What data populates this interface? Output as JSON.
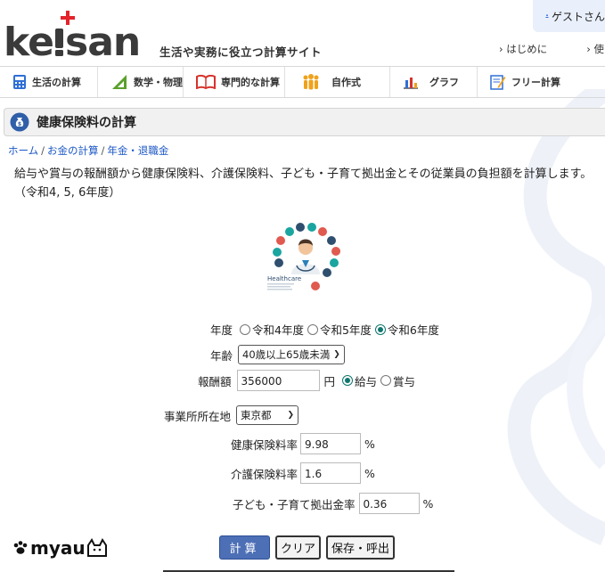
{
  "header": {
    "guest_label": "ゲストさん",
    "logo_text": "keisan",
    "tagline": "生活や実務に役立つ計算サイト",
    "links": [
      "はじめに",
      "使い"
    ]
  },
  "nav": {
    "items": [
      {
        "label": "生活の計算",
        "icon": "calculator-icon"
      },
      {
        "label": "数学・物理",
        "icon": "triangle-ruler-icon"
      },
      {
        "label": "専門的な計算",
        "icon": "book-icon"
      },
      {
        "label": "自作式",
        "icon": "people-icon"
      },
      {
        "label": "グラフ",
        "icon": "bar-chart-icon"
      },
      {
        "label": "フリー計算",
        "icon": "pencil-note-icon"
      }
    ]
  },
  "page": {
    "title": "健康保険料の計算",
    "breadcrumb": [
      "ホーム",
      "お金の計算",
      "年金・退職金"
    ],
    "description_line1": "給与や賞与の報酬額から健康保険料、介護保険料、子ども・子育て拠出金とその従業員の負担額を計算します。",
    "description_line2": "（令和4, 5, 6年度）",
    "illustration_text": "Healthcare"
  },
  "form": {
    "year_label": "年度",
    "year_options": [
      "令和4年度",
      "令和5年度",
      "令和6年度"
    ],
    "year_selected": "令和6年度",
    "age_label": "年齢",
    "age_value": "40歳以上65歳未満",
    "pay_label": "報酬額",
    "pay_value": "356000",
    "pay_unit": "円",
    "pay_type_options": [
      "給与",
      "賞与"
    ],
    "pay_type_selected": "給与",
    "location_label": "事業所所在地",
    "location_value": "東京都",
    "health_rate_label": "健康保険料率",
    "health_rate_value": "9.98",
    "care_rate_label": "介護保険料率",
    "care_rate_value": "1.6",
    "child_rate_label": "子ども・子育て拠出金率",
    "child_rate_value": "0.36",
    "percent": "%"
  },
  "buttons": {
    "calc": "計算",
    "clear": "クリア",
    "save": "保存・呼出"
  },
  "watermark": "myau",
  "colors": {
    "accent": "#4d6fb6",
    "radio_checked": "#0f766e",
    "logo_dark": "#3a3a3a",
    "logo_red": "#e4232b"
  }
}
